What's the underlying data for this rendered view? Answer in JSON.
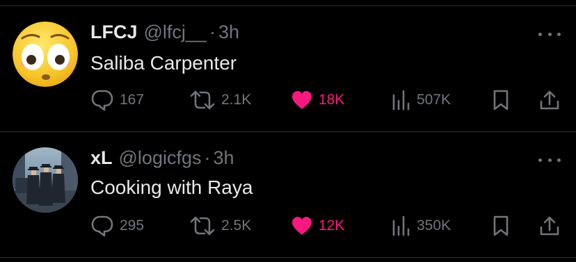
{
  "colors": {
    "background": "#000000",
    "divider": "#2f3336",
    "text": "#e7e9ea",
    "muted": "#71767b",
    "like": "#f91880"
  },
  "tweets": [
    {
      "display_name": "LFCJ",
      "handle": "@lfcj__",
      "separator": "·",
      "time": "3h",
      "text": "Saliba Carpenter",
      "avatar_icon": "flushed-emoji-avatar",
      "replies": "167",
      "retweets": "2.1K",
      "likes": "18K",
      "liked": true,
      "views": "507K"
    },
    {
      "display_name": "xL",
      "handle": "@logicfgs",
      "separator": "·",
      "time": "3h",
      "text": "Cooking with Raya",
      "avatar_icon": "men-in-suits-photo-avatar",
      "replies": "295",
      "retweets": "2.5K",
      "likes": "12K",
      "liked": true,
      "views": "350K"
    }
  ]
}
